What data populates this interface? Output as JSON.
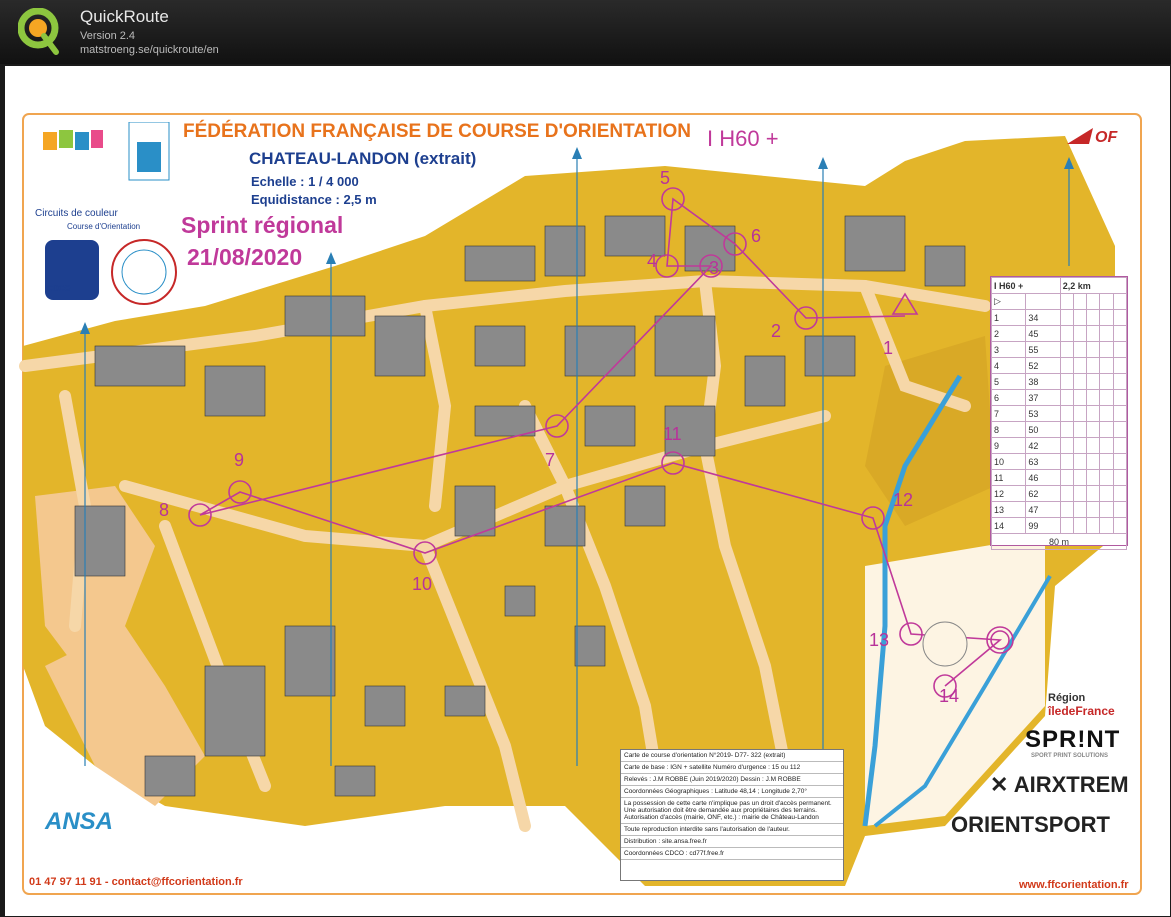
{
  "app": {
    "title": "QuickRoute",
    "version": "Version 2.4",
    "url": "matstroeng.se/quickroute/en"
  },
  "map": {
    "federation": "FÉDÉRATION FRANÇAISE DE COURSE D'ORIENTATION",
    "name": "CHATEAU-LANDON (extrait)",
    "scale": "Echelle : 1 / 4 000",
    "equidistance": "Equidistance : 2,5 m",
    "event": "Sprint régional",
    "date": "21/08/2020",
    "course": "I H60 +",
    "controls": [
      "1",
      "2",
      "3",
      "4",
      "5",
      "6",
      "7",
      "8",
      "9",
      "10",
      "11",
      "12",
      "13",
      "14"
    ],
    "phone": "01 47 97 11 91 - contact@ffcorientation.fr",
    "website": "www.ffcorientation.fr",
    "colors": {
      "map_yellow": "#e3b52a",
      "map_open": "#f4c88e",
      "building": "#8a8a8a",
      "course_purple": "#c0399a",
      "water_blue": "#3aa0d8"
    }
  },
  "description_table": {
    "header": [
      "I H60 +",
      "2,2 km"
    ],
    "rows": [
      [
        "1",
        "34"
      ],
      [
        "2",
        "45"
      ],
      [
        "3",
        "55"
      ],
      [
        "4",
        "52"
      ],
      [
        "5",
        "38"
      ],
      [
        "6",
        "37"
      ],
      [
        "7",
        "53"
      ],
      [
        "8",
        "50"
      ],
      [
        "9",
        "42"
      ],
      [
        "10",
        "63"
      ],
      [
        "11",
        "46"
      ],
      [
        "12",
        "62"
      ],
      [
        "13",
        "47"
      ],
      [
        "14",
        "99"
      ]
    ],
    "finish": "80 m"
  },
  "info_box": [
    "Carte de course d'orientation N°2019- D77- 322 (extrait)",
    "Carte de base : IGN + satellite    Numéro d'urgence : 15 ou 112",
    "Relevés : J.M ROBBE (Juin 2019/2020)   Dessin : J.M ROBBE",
    "Coordonnées Géographiques : Latitude 48,14 ; Longitude 2,70°",
    "La possession de cette carte n'implique pas un droit d'accès permanent. Une autorisation doit être demandée aux propriétaires des terrains. Autorisation d'accès (mairie, ONF, etc.) : mairie de Château-Landon",
    "Toute reproduction interdite sans l'autorisation de l'auteur.",
    "Distribution : site.ansa.free.fr",
    "Coordonnées CDCO : cd77f.free.fr"
  ],
  "sponsors": {
    "region_top": "Région",
    "region_bottom": "îledeFrance",
    "sprint": "SPR!NT",
    "sprint_sub": "SPORT PRINT SOLUTIONS",
    "airxtrem": "✕ AIRXTREM",
    "orientsport": "ORIENTSPORT",
    "ansa": "ANSA",
    "circuits": "Circuits de couleur",
    "circuits_sub": "Course d'Orientation",
    "cdco": "CDCO"
  }
}
